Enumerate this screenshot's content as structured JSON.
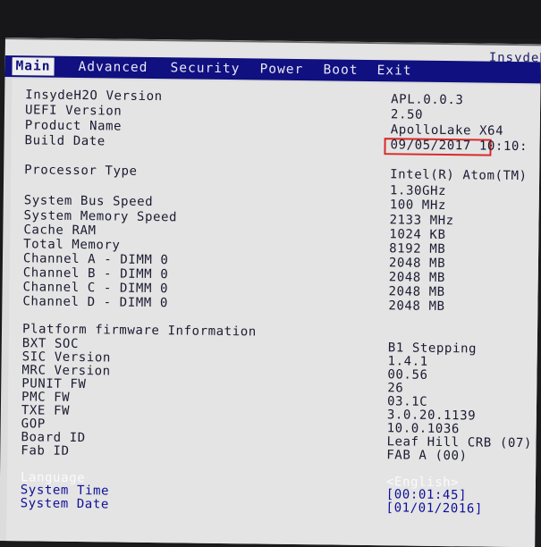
{
  "window": {
    "brand": "InsydeH"
  },
  "tabs": [
    "Main",
    "Advanced",
    "Security",
    "Power",
    "Boot",
    "Exit"
  ],
  "info_rows": [
    {
      "label": "InsydeH2O Version",
      "value": "APL.0.0.3"
    },
    {
      "label": "UEFI Version",
      "value": "2.50"
    },
    {
      "label": "Product Name",
      "value": "ApolloLake X64"
    },
    {
      "label": "Build Date",
      "value": "09/05/2017 10:10:"
    },
    {
      "label": "Processor Type",
      "value": "Intel(R) Atom(TM)"
    },
    {
      "label": "",
      "value": "1.30GHz"
    },
    {
      "label": "System Bus Speed",
      "value": "100 MHz"
    },
    {
      "label": "System Memory Speed",
      "value": "2133 MHz"
    },
    {
      "label": "Cache RAM",
      "value": "1024 KB"
    },
    {
      "label": "Total Memory",
      "value": "8192 MB"
    },
    {
      "label": "Channel A - DIMM 0",
      "value": "2048 MB"
    },
    {
      "label": "Channel B - DIMM 0",
      "value": "2048 MB"
    },
    {
      "label": "Channel C - DIMM 0",
      "value": "2048 MB"
    },
    {
      "label": "Channel D - DIMM 0",
      "value": "2048 MB"
    }
  ],
  "platform": {
    "heading": "Platform firmware Information",
    "rows": [
      {
        "label": "BXT SOC",
        "value": "B1 Stepping"
      },
      {
        "label": "SIC Version",
        "value": "1.4.1"
      },
      {
        "label": "MRC Version",
        "value": "00.56"
      },
      {
        "label": "PUNIT FW",
        "value": "26"
      },
      {
        "label": "PMC FW",
        "value": "03.1C"
      },
      {
        "label": "TXE FW",
        "value": "3.0.20.1139"
      },
      {
        "label": "GOP",
        "value": "10.0.1036"
      },
      {
        "label": "Board ID",
        "value": "Leaf Hill CRB (07)"
      },
      {
        "label": "Fab ID",
        "value": "FAB A (00)"
      }
    ]
  },
  "settings": {
    "language": {
      "label": "Language",
      "value": "<English>"
    },
    "time": {
      "label": "System Time",
      "value": "[00:01:45]"
    },
    "date": {
      "label": "System Date",
      "value": "[01/01/2016]"
    }
  },
  "colors": {
    "menubar": "#101080",
    "panel": "#e4e4e4",
    "highlight_box": "#d82a2a",
    "setting_text": "#0f0f9a"
  }
}
